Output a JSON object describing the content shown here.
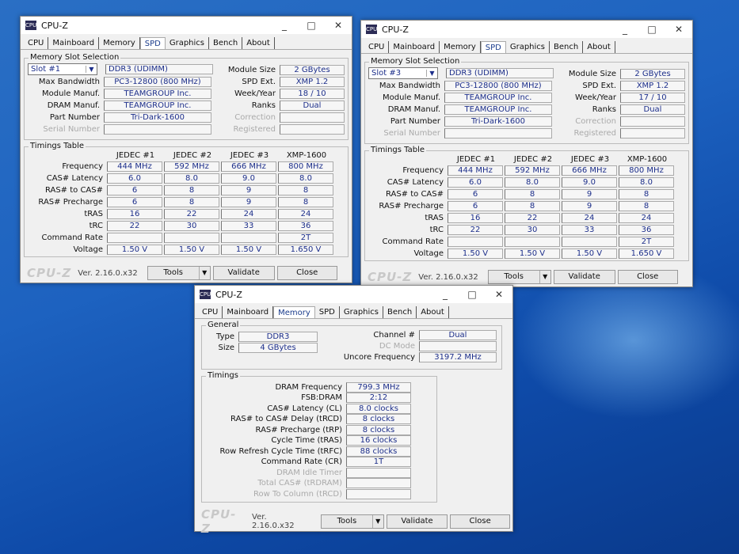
{
  "common": {
    "title": "CPU-Z",
    "icon": "cpu-z-icon",
    "tabs": [
      "CPU",
      "Mainboard",
      "Memory",
      "SPD",
      "Graphics",
      "Bench",
      "About"
    ],
    "brand": "CPU-Z",
    "version": "Ver. 2.16.0.x32",
    "tools": "Tools",
    "validate": "Validate",
    "close": "Close",
    "minimize": "_",
    "maximize": "□",
    "close_x": "✕"
  },
  "spd_labels": {
    "group": "Memory Slot Selection",
    "left": [
      "Max Bandwidth",
      "Module Manuf.",
      "DRAM Manuf.",
      "Part Number",
      "Serial Number"
    ],
    "right": [
      "Module Size",
      "SPD Ext.",
      "Week/Year",
      "Ranks",
      "Correction",
      "Registered"
    ],
    "timings_group": "Timings Table",
    "timing_rows": [
      "Frequency",
      "CAS# Latency",
      "RAS# to CAS#",
      "RAS# Precharge",
      "tRAS",
      "tRC",
      "Command Rate",
      "Voltage"
    ],
    "columns": [
      "JEDEC #1",
      "JEDEC #2",
      "JEDEC #3",
      "XMP-1600"
    ]
  },
  "windows": [
    {
      "active_tab": "SPD",
      "slot": "Slot #1",
      "type": "DDR3 (UDIMM)",
      "left_values": [
        "PC3-12800 (800 MHz)",
        "TEAMGROUP Inc.",
        "TEAMGROUP Inc.",
        "Tri-Dark-1600",
        ""
      ],
      "right_values": [
        "2 GBytes",
        "XMP 1.2",
        "18 / 10",
        "Dual",
        "",
        ""
      ],
      "timings": [
        [
          "444 MHz",
          "592 MHz",
          "666 MHz",
          "800 MHz"
        ],
        [
          "6.0",
          "8.0",
          "9.0",
          "8.0"
        ],
        [
          "6",
          "8",
          "9",
          "8"
        ],
        [
          "6",
          "8",
          "9",
          "8"
        ],
        [
          "16",
          "22",
          "24",
          "24"
        ],
        [
          "22",
          "30",
          "33",
          "36"
        ],
        [
          "",
          "",
          "",
          "2T"
        ],
        [
          "1.50 V",
          "1.50 V",
          "1.50 V",
          "1.650 V"
        ]
      ]
    },
    {
      "active_tab": "SPD",
      "slot": "Slot #3",
      "type": "DDR3 (UDIMM)",
      "left_values": [
        "PC3-12800 (800 MHz)",
        "TEAMGROUP Inc.",
        "TEAMGROUP Inc.",
        "Tri-Dark-1600",
        ""
      ],
      "right_values": [
        "2 GBytes",
        "XMP 1.2",
        "17 / 10",
        "Dual",
        "",
        ""
      ],
      "timings": [
        [
          "444 MHz",
          "592 MHz",
          "666 MHz",
          "800 MHz"
        ],
        [
          "6.0",
          "8.0",
          "9.0",
          "8.0"
        ],
        [
          "6",
          "8",
          "9",
          "8"
        ],
        [
          "6",
          "8",
          "9",
          "8"
        ],
        [
          "16",
          "22",
          "24",
          "24"
        ],
        [
          "22",
          "30",
          "33",
          "36"
        ],
        [
          "",
          "",
          "",
          "2T"
        ],
        [
          "1.50 V",
          "1.50 V",
          "1.50 V",
          "1.650 V"
        ]
      ]
    }
  ],
  "memory": {
    "active_tab": "Memory",
    "general_group": "General",
    "type_label": "Type",
    "type": "DDR3",
    "size_label": "Size",
    "size": "4 GBytes",
    "channel_label": "Channel #",
    "channel": "Dual",
    "dc_mode_label": "DC Mode",
    "dc_mode": "",
    "uncore_label": "Uncore Frequency",
    "uncore": "3197.2 MHz",
    "timings_group": "Timings",
    "timings": [
      {
        "label": "DRAM Frequency",
        "value": "799.3 MHz"
      },
      {
        "label": "FSB:DRAM",
        "value": "2:12"
      },
      {
        "label": "CAS# Latency (CL)",
        "value": "8.0 clocks"
      },
      {
        "label": "RAS# to CAS# Delay (tRCD)",
        "value": "8 clocks"
      },
      {
        "label": "RAS# Precharge (tRP)",
        "value": "8 clocks"
      },
      {
        "label": "Cycle Time (tRAS)",
        "value": "16 clocks"
      },
      {
        "label": "Row Refresh Cycle Time (tRFC)",
        "value": "88 clocks"
      },
      {
        "label": "Command Rate (CR)",
        "value": "1T"
      },
      {
        "label": "DRAM Idle Timer",
        "value": "",
        "dim": true
      },
      {
        "label": "Total CAS# (tRDRAM)",
        "value": "",
        "dim": true
      },
      {
        "label": "Row To Column (tRCD)",
        "value": "",
        "dim": true
      }
    ]
  }
}
